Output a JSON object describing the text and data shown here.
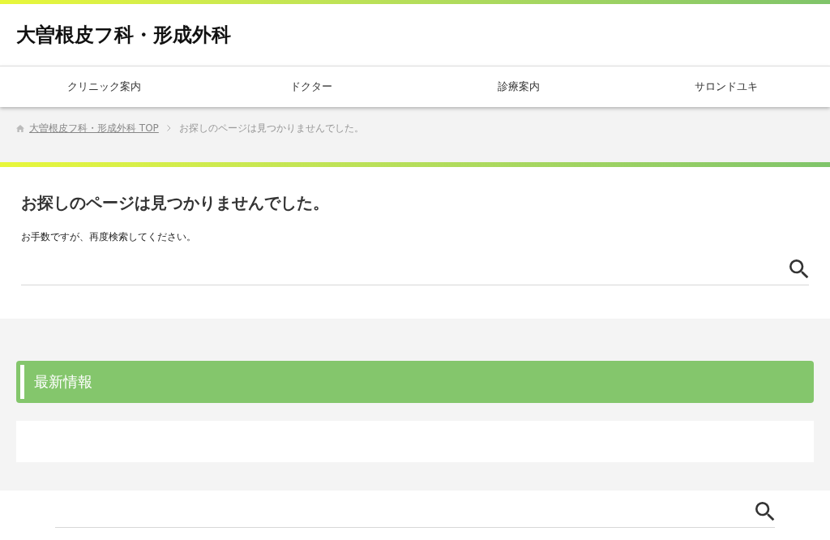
{
  "site_title": "大曽根皮フ科・形成外科",
  "nav": [
    {
      "label": "クリニック案内"
    },
    {
      "label": "ドクター"
    },
    {
      "label": "診療案内"
    },
    {
      "label": "サロンドユキ"
    }
  ],
  "breadcrumb": [
    {
      "label": "大曽根皮フ科・形成外科 TOP",
      "kind": "link"
    },
    {
      "label": "お探しのページは見つかりませんでした。",
      "kind": "current"
    }
  ],
  "main": {
    "heading": "お探しのページは見つかりませんでした。",
    "message": "お手数ですが、再度検索してください。"
  },
  "latest": {
    "title": "最新情報"
  }
}
